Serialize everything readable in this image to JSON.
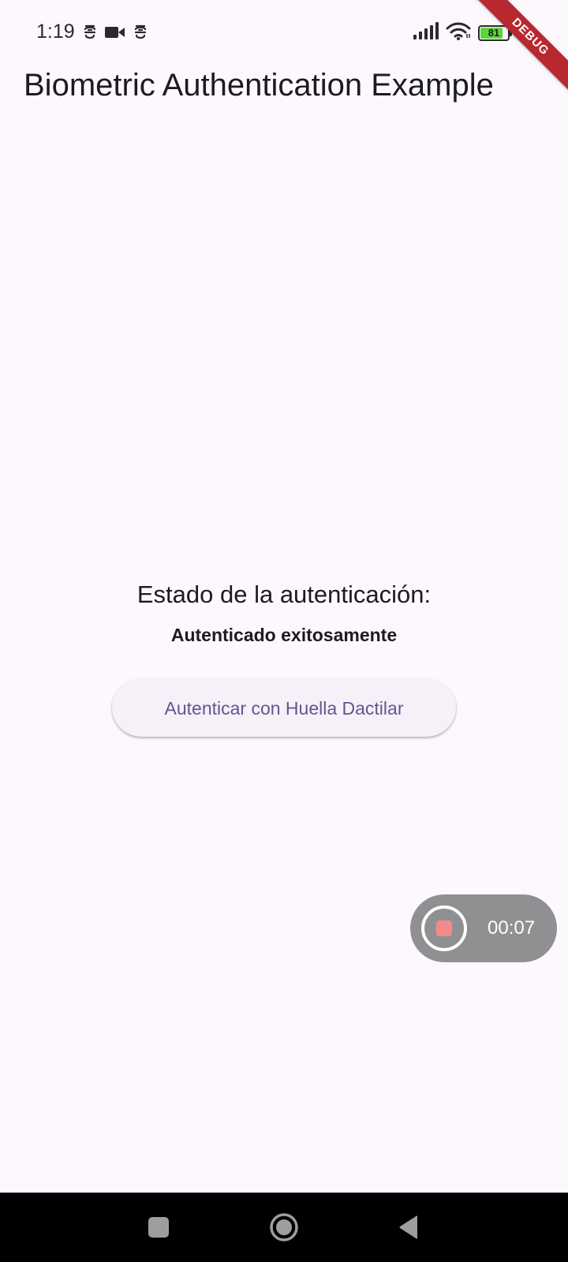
{
  "status_bar": {
    "time": "1:19",
    "battery_level": "81",
    "left_icons": [
      "notification-icon",
      "video-camera-icon",
      "notification-icon"
    ],
    "right_icons": [
      "signal-icon",
      "wifi-icon",
      "battery-icon"
    ]
  },
  "debug_banner": {
    "label": "DEBUG"
  },
  "app_bar": {
    "title": "Biometric Authentication Example"
  },
  "main": {
    "status_label": "Estado de la autenticación:",
    "status_value": "Autenticado exitosamente",
    "auth_button_label": "Autenticar con Huella Dactilar"
  },
  "recorder": {
    "elapsed": "00:07"
  },
  "nav_bar": {
    "buttons": [
      "recents-button",
      "home-button",
      "back-button"
    ]
  },
  "colors": {
    "background": "#fdf8fd",
    "button_background": "#f6f1f8",
    "button_text": "#65558f",
    "debug_ribbon": "#b8282f",
    "battery_fill": "#5fd442",
    "recorder_background": "#8f9092",
    "record_indicator": "#f28a8c"
  }
}
